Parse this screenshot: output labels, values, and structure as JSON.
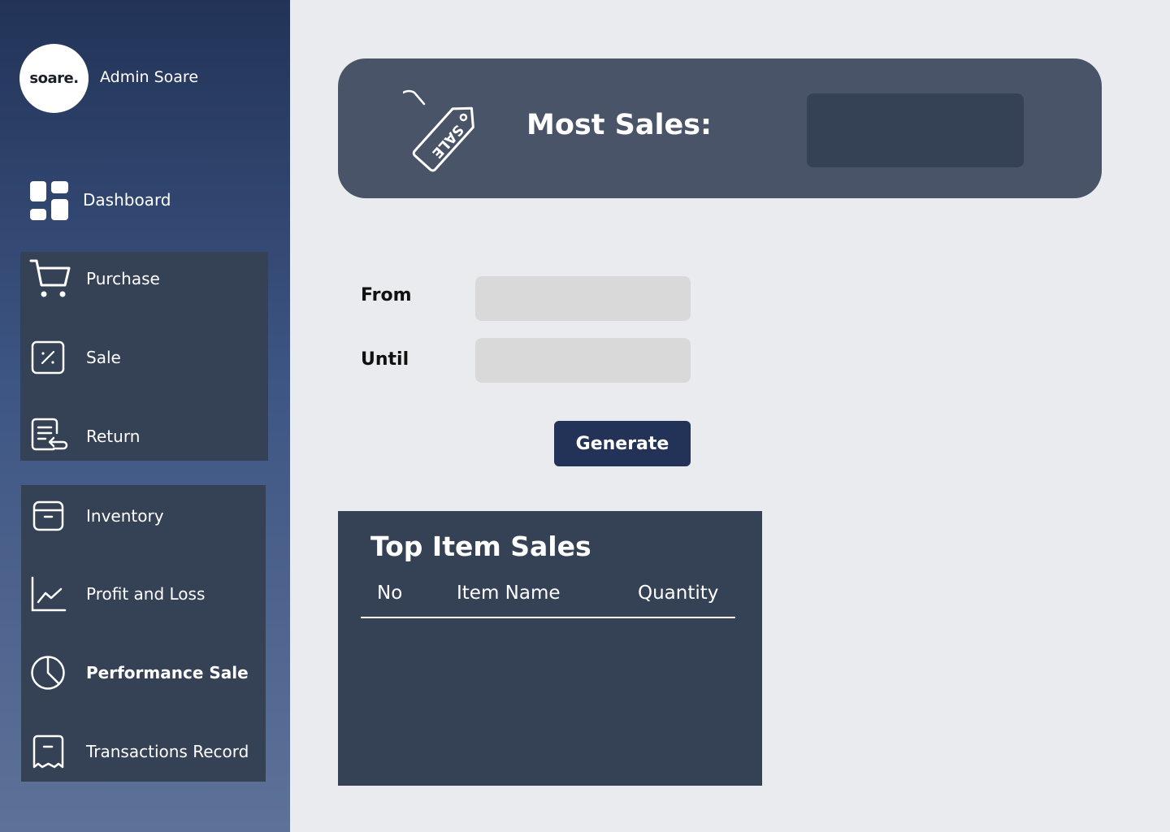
{
  "sidebar": {
    "logo_text": "soare.",
    "admin_name": "Admin Soare",
    "items": {
      "dashboard": "Dashboard",
      "purchase": "Purchase",
      "sale": "Sale",
      "return": "Return",
      "inventory": "Inventory",
      "profit_loss": "Profit and Loss",
      "performance_sale": "Performance Sale",
      "transactions": "Transactions Record"
    },
    "active_item": "Performance Sale"
  },
  "banner": {
    "icon_text": "SALE",
    "title": "Most Sales:",
    "value": ""
  },
  "filters": {
    "from_label": "From",
    "until_label": "Until",
    "from_value": "",
    "until_value": "",
    "generate_label": "Generate"
  },
  "table": {
    "title": "Top Item Sales",
    "columns": [
      "No",
      "Item Name",
      "Quantity"
    ],
    "rows": []
  },
  "colors": {
    "sidebar_top": "#223357",
    "sidebar_bottom": "#5E7298",
    "panel": "#354155",
    "banner": "#4A5468",
    "background": "#EAEBEF",
    "input": "#D9D9D9",
    "button": "#223357"
  }
}
